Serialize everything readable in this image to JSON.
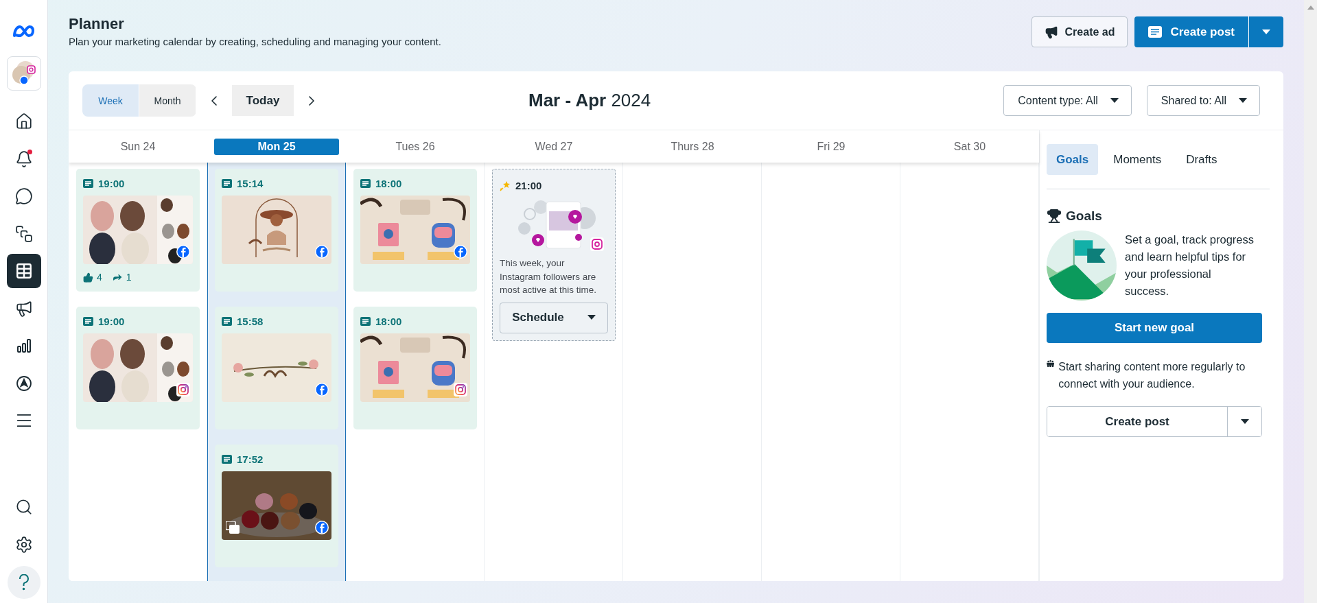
{
  "sidebar": {
    "items": [
      {
        "selected": false,
        "notification": false
      },
      {
        "selected": false,
        "notification": true
      },
      {
        "selected": false,
        "notification": false
      },
      {
        "selected": false,
        "notification": false
      },
      {
        "selected": true,
        "notification": false
      },
      {
        "selected": false,
        "notification": false
      },
      {
        "selected": false,
        "notification": false
      },
      {
        "selected": false,
        "notification": false
      },
      {
        "selected": false,
        "notification": false
      }
    ]
  },
  "header": {
    "title": "Planner",
    "subtitle": "Plan your marketing calendar by creating, scheduling and managing your content."
  },
  "actions": {
    "create_ad": "Create ad",
    "create_post": "Create post"
  },
  "toolbar": {
    "views": [
      {
        "label": "Week",
        "selected": true
      },
      {
        "label": "Month",
        "selected": false
      }
    ],
    "today": "Today",
    "range": "**Mar - Apr** 2024",
    "filters": [
      "Content type: All",
      "Shared to: All"
    ]
  },
  "days": [
    {
      "label": "Sun 24",
      "selected": false,
      "posts": [
        {
          "time": "19:00",
          "instagram": false,
          "carousel": false,
          "likes": "4",
          "shares": "1"
        },
        {
          "time": "19:00",
          "instagram": true,
          "carousel": false
        }
      ]
    },
    {
      "label": "Mon 25",
      "selected": true,
      "posts": [
        {
          "time": "15:14",
          "instagram": false,
          "carousel": false
        },
        {
          "time": "15:58",
          "instagram": false,
          "carousel": false
        },
        {
          "time": "17:52",
          "instagram": false,
          "carousel": true
        }
      ]
    },
    {
      "label": "Tues 26",
      "selected": false,
      "posts": [
        {
          "time": "18:00",
          "instagram": false,
          "carousel": false
        },
        {
          "time": "18:00",
          "instagram": true,
          "carousel": false
        }
      ]
    },
    {
      "label": "Wed 27",
      "selected": false,
      "suggestion": {
        "time": "21:00",
        "text": "This week, your Instagram followers are most active at this time.",
        "button": "Schedule"
      }
    },
    {
      "label": "Thurs 28",
      "selected": false
    },
    {
      "label": "Fri 29",
      "selected": false
    },
    {
      "label": "Sat 30",
      "selected": false
    }
  ],
  "panel": {
    "tabs": [
      {
        "label": "Goals",
        "selected": true
      },
      {
        "label": "Moments",
        "selected": false
      },
      {
        "label": "Drafts",
        "selected": false
      }
    ],
    "goals": {
      "title": "Goals",
      "text": "Set a goal, track progress and learn helpful tips for your professional success.",
      "button": "Start new goal",
      "tip": "Start sharing content more regularly to connect with your audience.",
      "create_post": "Create post"
    }
  }
}
